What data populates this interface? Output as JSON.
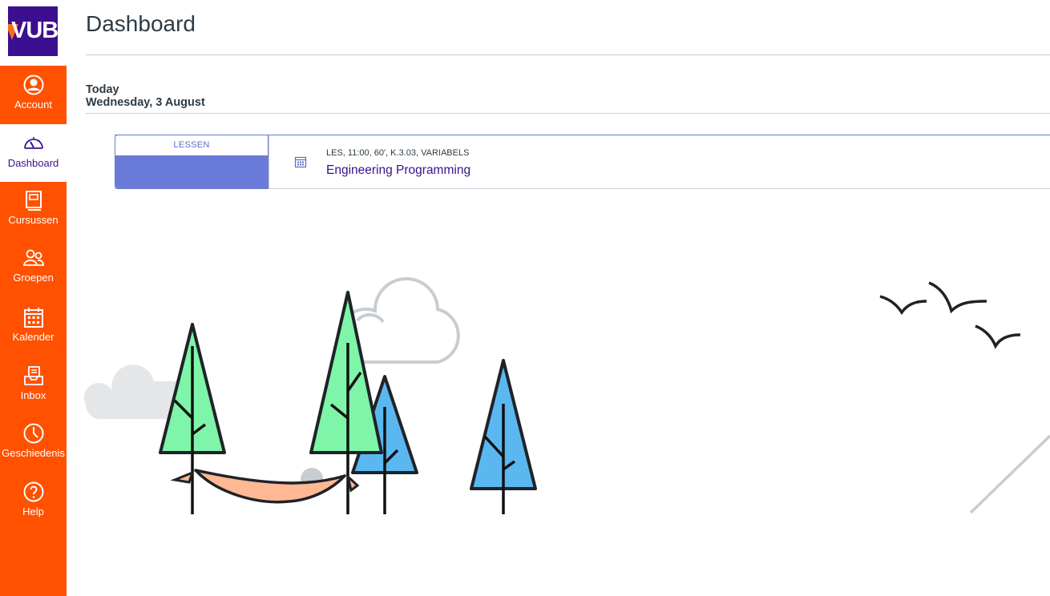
{
  "brand": {
    "logo_text": "VUB",
    "accent": "#ff5100",
    "brand_purple": "#3b0f8f"
  },
  "sidebar": {
    "items": [
      {
        "label": "Account",
        "icon": "user-circle-icon"
      },
      {
        "label": "Dashboard",
        "icon": "speedometer-icon",
        "active": true
      },
      {
        "label": "Cursussen",
        "icon": "book-icon"
      },
      {
        "label": "Groepen",
        "icon": "people-icon"
      },
      {
        "label": "Kalender",
        "icon": "calendar-icon"
      },
      {
        "label": "Inbox",
        "icon": "inbox-icon"
      },
      {
        "label": "Geschiedenis",
        "icon": "clock-icon"
      },
      {
        "label": "Help",
        "icon": "help-icon"
      }
    ]
  },
  "header": {
    "title": "Dashboard"
  },
  "planner": {
    "day_label": "Today",
    "date_label": "Wednesday, 3 August",
    "items": [
      {
        "course_tag": "LESSEN",
        "course_color": "#6a7ad8",
        "meta": "LES, 11:00, 60', K.3.03, VARIABELS",
        "title": "Engineering Programming",
        "icon": "calendar-icon"
      }
    ]
  }
}
